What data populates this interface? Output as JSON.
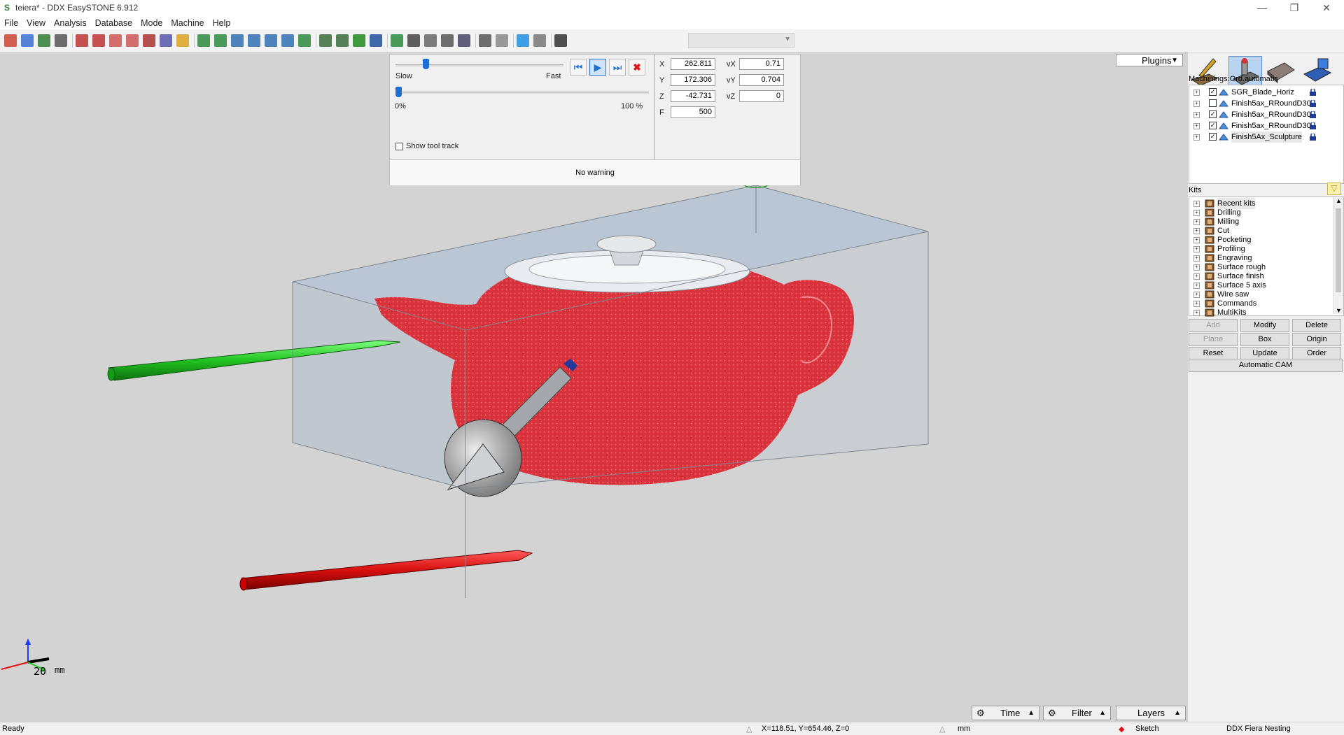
{
  "window": {
    "title": "teiera* - DDX EasySTONE 6.912",
    "app_icon": "S",
    "minimize": "—",
    "maximize": "❐",
    "close": "✕"
  },
  "menu": [
    "File",
    "View",
    "Analysis",
    "Database",
    "Mode",
    "Machine",
    "Help"
  ],
  "toolbar_icons": [
    "new-icon",
    "open-icon",
    "save-icon",
    "print-icon",
    "select-icon",
    "zoom-window-icon",
    "zoom-out-icon",
    "zoom-in-icon",
    "pan-hand-icon",
    "rotate-icon",
    "light-bulb-icon",
    "view-front-icon",
    "view-back-icon",
    "view-left-icon",
    "view-right-icon",
    "view-top-icon",
    "view-iso-icon",
    "view-axis-icon",
    "shield-outline-icon",
    "shield-hollow-icon",
    "shield-green-icon",
    "shield-blue-icon",
    "render-mesh-icon",
    "machine-icon",
    "tool-icon",
    "measure-icon",
    "document-icon",
    "undo-icon",
    "redo-icon",
    "help-icon",
    "mail-icon",
    "clipboard-icon"
  ],
  "simulation": {
    "speed_slow": "Slow",
    "speed_fast": "Fast",
    "speed_level": 0.18,
    "progress_min": "0%",
    "progress_max": "100 %",
    "progress_level": 0.0,
    "show_tool_track": "Show tool track",
    "status": "No warning",
    "coords": [
      {
        "label": "X",
        "value": "262.811",
        "vlabel": "vX",
        "vvalue": "0.71"
      },
      {
        "label": "Y",
        "value": "172.306",
        "vlabel": "vY",
        "vvalue": "0.704"
      },
      {
        "label": "Z",
        "value": "-42.731",
        "vlabel": "vZ",
        "vvalue": "0"
      },
      {
        "label": "F",
        "value": "500"
      }
    ]
  },
  "right_panel": {
    "plugins": "Plugins",
    "machinings_label": "Machinings:Ord.automatic",
    "machinings": [
      {
        "label": "SGR_Blade_Horiz",
        "checked": true
      },
      {
        "label": "Finish5ax_RRoundD30",
        "checked": false
      },
      {
        "label": "Finish5ax_RRoundD30",
        "checked": true
      },
      {
        "label": "Finish5ax_RRoundD30",
        "checked": true
      },
      {
        "label": "Finish5Ax_Sculpture",
        "checked": true
      }
    ],
    "kits_label": "Kits",
    "kits": [
      "Recent kits",
      "Drilling",
      "Milling",
      "Cut",
      "Pocketing",
      "Profiling",
      "Engraving",
      "Surface rough",
      "Surface finish",
      "Surface 5 axis",
      "Wire saw",
      "Commands",
      "MultiKits"
    ],
    "buttons": [
      [
        {
          "label": "Add",
          "enabled": false
        },
        {
          "label": "Modify",
          "enabled": true
        },
        {
          "label": "Delete",
          "enabled": true
        }
      ],
      [
        {
          "label": "Plane",
          "enabled": false
        },
        {
          "label": "Box",
          "enabled": true
        },
        {
          "label": "Origin",
          "enabled": true
        }
      ],
      [
        {
          "label": "Reset",
          "enabled": true
        },
        {
          "label": "Update",
          "enabled": true
        },
        {
          "label": "Order",
          "enabled": true
        }
      ]
    ],
    "automatic_cam": "Automatic CAM"
  },
  "viewport": {
    "scale_value": "20",
    "scale_unit": "mm"
  },
  "bottom_buttons": {
    "time": "Time",
    "filter": "Filter",
    "layers": "Layers"
  },
  "status": {
    "ready": "Ready",
    "coords": "X=118.51, Y=654.46, Z=0",
    "unit": "mm",
    "mode": "Sketch",
    "app": "DDX Fiera Nesting"
  },
  "colors": {
    "accent": "#1f6ed4",
    "toolpath": "#d8333c",
    "viewport_bg": "#d3d3d3",
    "green_axis": "#2ecc2e",
    "red_axis": "#e01414"
  }
}
